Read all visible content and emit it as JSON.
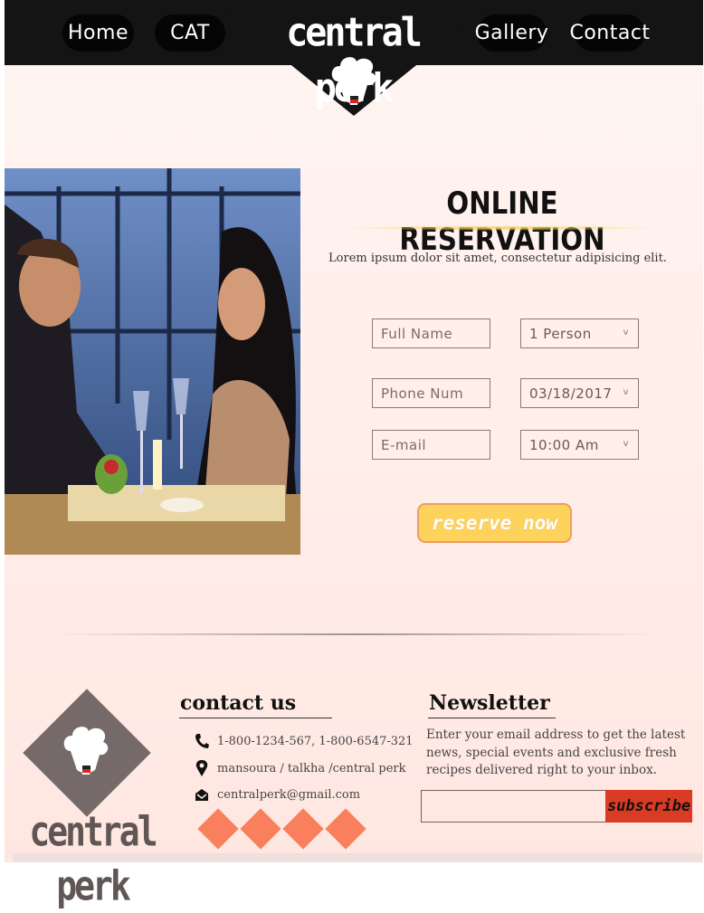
{
  "header": {
    "nav": {
      "home": "Home",
      "cat": "CAT",
      "gallery": "Gallery",
      "contact": "Contact"
    },
    "logo": "central perk"
  },
  "reservation": {
    "title": "ONLINE RESERVATION",
    "subtitle": "Lorem ipsum dolor sit amet, consectetur adipisicing elit.",
    "full_name_placeholder": "Full Name",
    "phone_placeholder": "Phone Num",
    "email_placeholder": "E-mail",
    "persons": "1 Person",
    "date": "03/18/2017",
    "time": "10:00 Am",
    "reserve_label": "reserve now"
  },
  "footer": {
    "logo": "central perk",
    "contact": {
      "heading": "contact us",
      "phone": "1-800-1234-567, 1-800-6547-321",
      "address": "mansoura / talkha /central perk",
      "email": "centralperk@gmail.com"
    },
    "newsletter": {
      "heading": "Newsletter",
      "text": "Enter your email address to get the latest news, special events and exclusive fresh recipes delivered right to your inbox.",
      "subscribe_label": "subscribe"
    }
  },
  "colors": {
    "header_bg": "#141414",
    "accent_yellow": "#fdd35c",
    "accent_orange": "#fa7f5c",
    "subscribe_red": "#d93b24"
  },
  "icons": [
    "chef-hat-icon",
    "phone-icon",
    "location-icon",
    "mail-icon"
  ]
}
